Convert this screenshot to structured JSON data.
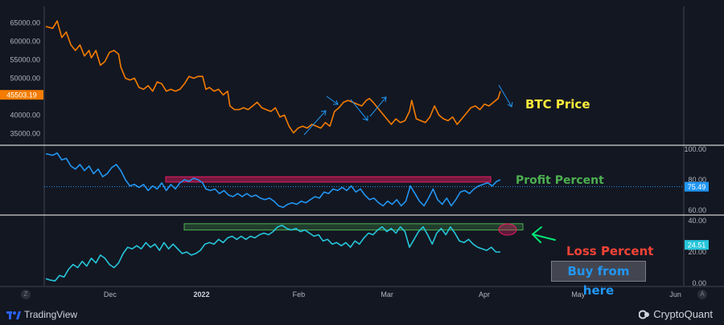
{
  "chart_data": [
    {
      "type": "line",
      "id": "btc-price",
      "series": [
        {
          "name": "BTC Price",
          "color": "#f57c00"
        }
      ],
      "y_ticks": [
        "65000.00",
        "60000.00",
        "55000.00",
        "50000.00",
        "40000.00",
        "35000.00"
      ],
      "y_tick_values": [
        65000,
        60000,
        55000,
        50000,
        40000,
        35000
      ],
      "ylim": [
        32500,
        69000
      ],
      "last_value_label": "45503.19",
      "last_value": 45503.19,
      "annotation": "BTC Price",
      "points": [
        [
          0,
          64000
        ],
        [
          0.015,
          63500
        ],
        [
          0.025,
          65500
        ],
        [
          0.035,
          61000
        ],
        [
          0.045,
          62500
        ],
        [
          0.055,
          59000
        ],
        [
          0.065,
          57500
        ],
        [
          0.075,
          59000
        ],
        [
          0.085,
          56000
        ],
        [
          0.095,
          57500
        ],
        [
          0.1,
          55500
        ],
        [
          0.11,
          57500
        ],
        [
          0.12,
          53500
        ],
        [
          0.13,
          54500
        ],
        [
          0.14,
          57000
        ],
        [
          0.15,
          57500
        ],
        [
          0.16,
          56500
        ],
        [
          0.165,
          53000
        ],
        [
          0.175,
          50000
        ],
        [
          0.185,
          49500
        ],
        [
          0.195,
          50000
        ],
        [
          0.205,
          47500
        ],
        [
          0.215,
          47000
        ],
        [
          0.225,
          48000
        ],
        [
          0.235,
          46500
        ],
        [
          0.245,
          49000
        ],
        [
          0.255,
          48500
        ],
        [
          0.265,
          46500
        ],
        [
          0.275,
          47000
        ],
        [
          0.285,
          46500
        ],
        [
          0.295,
          47000
        ],
        [
          0.305,
          48500
        ],
        [
          0.315,
          50500
        ],
        [
          0.325,
          50000
        ],
        [
          0.335,
          50500
        ],
        [
          0.345,
          50500
        ],
        [
          0.352,
          47000
        ],
        [
          0.36,
          47500
        ],
        [
          0.37,
          46500
        ],
        [
          0.38,
          47000
        ],
        [
          0.39,
          45500
        ],
        [
          0.4,
          46500
        ],
        [
          0.405,
          42500
        ],
        [
          0.415,
          41500
        ],
        [
          0.425,
          41500
        ],
        [
          0.435,
          42000
        ],
        [
          0.445,
          41500
        ],
        [
          0.455,
          42500
        ],
        [
          0.465,
          43500
        ],
        [
          0.475,
          42000
        ],
        [
          0.485,
          41500
        ],
        [
          0.495,
          41000
        ],
        [
          0.505,
          42000
        ],
        [
          0.515,
          39500
        ],
        [
          0.525,
          40000
        ],
        [
          0.535,
          37000
        ],
        [
          0.545,
          35200
        ],
        [
          0.555,
          36500
        ],
        [
          0.565,
          37000
        ],
        [
          0.575,
          36500
        ],
        [
          0.585,
          37500
        ],
        [
          0.595,
          37000
        ],
        [
          0.605,
          36500
        ],
        [
          0.615,
          38000
        ],
        [
          0.625,
          37000
        ],
        [
          0.635,
          41000
        ],
        [
          0.645,
          42000
        ],
        [
          0.655,
          43500
        ],
        [
          0.665,
          44000
        ],
        [
          0.675,
          43500
        ],
        [
          0.685,
          43000
        ],
        [
          0.695,
          42500
        ],
        [
          0.705,
          44000
        ],
        [
          0.712,
          44500
        ],
        [
          0.72,
          43500
        ],
        [
          0.73,
          42000
        ],
        [
          0.74,
          40500
        ],
        [
          0.75,
          39000
        ],
        [
          0.76,
          37500
        ],
        [
          0.77,
          39000
        ],
        [
          0.78,
          38000
        ],
        [
          0.79,
          38500
        ],
        [
          0.8,
          41000
        ],
        [
          0.805,
          44000
        ],
        [
          0.815,
          39000
        ],
        [
          0.825,
          38500
        ],
        [
          0.835,
          38000
        ],
        [
          0.845,
          39500
        ],
        [
          0.855,
          42500
        ],
        [
          0.865,
          40000
        ],
        [
          0.875,
          39000
        ],
        [
          0.885,
          38500
        ],
        [
          0.895,
          39500
        ],
        [
          0.905,
          37500
        ],
        [
          0.915,
          39000
        ],
        [
          0.925,
          40500
        ],
        [
          0.935,
          42000
        ],
        [
          0.945,
          42500
        ],
        [
          0.955,
          41500
        ],
        [
          0.965,
          43000
        ],
        [
          0.975,
          42500
        ],
        [
          0.985,
          43500
        ],
        [
          0.995,
          44500
        ],
        [
          1.0,
          46500
        ]
      ]
    },
    {
      "type": "line",
      "id": "profit-percent",
      "series": [
        {
          "name": "Profit Percent",
          "color": "#2196f3"
        }
      ],
      "y_ticks": [
        "100.00",
        "80.00",
        "60.00"
      ],
      "y_tick_values": [
        100,
        80,
        60
      ],
      "ylim": [
        58,
        101
      ],
      "last_value_label": "75.49",
      "last_value": 75.49,
      "annotation": "Profit Percent",
      "highlight_band": [
        78.5,
        82
      ],
      "points": [
        [
          0,
          97
        ],
        [
          0.015,
          96
        ],
        [
          0.025,
          97.5
        ],
        [
          0.035,
          93
        ],
        [
          0.045,
          94
        ],
        [
          0.055,
          89
        ],
        [
          0.065,
          87
        ],
        [
          0.075,
          90
        ],
        [
          0.085,
          86
        ],
        [
          0.095,
          89
        ],
        [
          0.105,
          84
        ],
        [
          0.115,
          87
        ],
        [
          0.125,
          82
        ],
        [
          0.135,
          84
        ],
        [
          0.145,
          88
        ],
        [
          0.155,
          90
        ],
        [
          0.165,
          86
        ],
        [
          0.175,
          80
        ],
        [
          0.185,
          76
        ],
        [
          0.195,
          77
        ],
        [
          0.205,
          75
        ],
        [
          0.215,
          77
        ],
        [
          0.225,
          73
        ],
        [
          0.235,
          76
        ],
        [
          0.245,
          74
        ],
        [
          0.255,
          78
        ],
        [
          0.265,
          73
        ],
        [
          0.275,
          77
        ],
        [
          0.285,
          74
        ],
        [
          0.295,
          78
        ],
        [
          0.305,
          80
        ],
        [
          0.315,
          79
        ],
        [
          0.325,
          81
        ],
        [
          0.335,
          80
        ],
        [
          0.345,
          78
        ],
        [
          0.352,
          74
        ],
        [
          0.362,
          73
        ],
        [
          0.372,
          74
        ],
        [
          0.382,
          71
        ],
        [
          0.392,
          73
        ],
        [
          0.402,
          70
        ],
        [
          0.412,
          69
        ],
        [
          0.422,
          71
        ],
        [
          0.432,
          69
        ],
        [
          0.442,
          71
        ],
        [
          0.452,
          69
        ],
        [
          0.462,
          70
        ],
        [
          0.472,
          68
        ],
        [
          0.482,
          67
        ],
        [
          0.492,
          68
        ],
        [
          0.502,
          66
        ],
        [
          0.512,
          63
        ],
        [
          0.522,
          62
        ],
        [
          0.532,
          64
        ],
        [
          0.542,
          65
        ],
        [
          0.552,
          64
        ],
        [
          0.562,
          66
        ],
        [
          0.572,
          65
        ],
        [
          0.582,
          67
        ],
        [
          0.592,
          69
        ],
        [
          0.602,
          68
        ],
        [
          0.612,
          72
        ],
        [
          0.622,
          71
        ],
        [
          0.632,
          74
        ],
        [
          0.642,
          73
        ],
        [
          0.652,
          75
        ],
        [
          0.662,
          73
        ],
        [
          0.672,
          76
        ],
        [
          0.682,
          72
        ],
        [
          0.692,
          74
        ],
        [
          0.702,
          70
        ],
        [
          0.712,
          67
        ],
        [
          0.722,
          68
        ],
        [
          0.732,
          65
        ],
        [
          0.742,
          63
        ],
        [
          0.752,
          66
        ],
        [
          0.762,
          64
        ],
        [
          0.772,
          67
        ],
        [
          0.782,
          63
        ],
        [
          0.792,
          66
        ],
        [
          0.802,
          76
        ],
        [
          0.812,
          71
        ],
        [
          0.822,
          66
        ],
        [
          0.832,
          63
        ],
        [
          0.842,
          68
        ],
        [
          0.852,
          74
        ],
        [
          0.862,
          67
        ],
        [
          0.872,
          64
        ],
        [
          0.882,
          68
        ],
        [
          0.892,
          63
        ],
        [
          0.902,
          67
        ],
        [
          0.912,
          72
        ],
        [
          0.922,
          73
        ],
        [
          0.932,
          71
        ],
        [
          0.942,
          74
        ],
        [
          0.952,
          76
        ],
        [
          0.962,
          77
        ],
        [
          0.972,
          78
        ],
        [
          0.982,
          76
        ],
        [
          0.992,
          79
        ],
        [
          1.0,
          80
        ]
      ]
    },
    {
      "type": "line",
      "id": "loss-percent",
      "series": [
        {
          "name": "Loss Percent",
          "color": "#26c6da"
        }
      ],
      "y_ticks": [
        "40.00",
        "20.00",
        "0.00"
      ],
      "y_tick_values": [
        40,
        20,
        0
      ],
      "ylim": [
        -1,
        42
      ],
      "last_value_label": "24.51",
      "last_value": 24.51,
      "annotation": "Loss Percent",
      "highlight_band": [
        34,
        38
      ],
      "points": [
        [
          0,
          3
        ],
        [
          0.01,
          2
        ],
        [
          0.02,
          1.5
        ],
        [
          0.03,
          5
        ],
        [
          0.04,
          4
        ],
        [
          0.05,
          9
        ],
        [
          0.06,
          12
        ],
        [
          0.07,
          10
        ],
        [
          0.08,
          14
        ],
        [
          0.09,
          11
        ],
        [
          0.1,
          16
        ],
        [
          0.11,
          13
        ],
        [
          0.12,
          18
        ],
        [
          0.13,
          16
        ],
        [
          0.14,
          12
        ],
        [
          0.15,
          10
        ],
        [
          0.16,
          13
        ],
        [
          0.17,
          19
        ],
        [
          0.18,
          23
        ],
        [
          0.19,
          22
        ],
        [
          0.2,
          24
        ],
        [
          0.21,
          22
        ],
        [
          0.22,
          26
        ],
        [
          0.23,
          23
        ],
        [
          0.24,
          25
        ],
        [
          0.25,
          21
        ],
        [
          0.26,
          26
        ],
        [
          0.27,
          22
        ],
        [
          0.28,
          25
        ],
        [
          0.29,
          22
        ],
        [
          0.3,
          19
        ],
        [
          0.31,
          20
        ],
        [
          0.32,
          18
        ],
        [
          0.33,
          19
        ],
        [
          0.34,
          21
        ],
        [
          0.35,
          25
        ],
        [
          0.36,
          26
        ],
        [
          0.37,
          25
        ],
        [
          0.38,
          28
        ],
        [
          0.39,
          26
        ],
        [
          0.4,
          29
        ],
        [
          0.41,
          30
        ],
        [
          0.42,
          28
        ],
        [
          0.43,
          30
        ],
        [
          0.44,
          28
        ],
        [
          0.45,
          30
        ],
        [
          0.46,
          29
        ],
        [
          0.47,
          31
        ],
        [
          0.48,
          32
        ],
        [
          0.49,
          31
        ],
        [
          0.5,
          33
        ],
        [
          0.51,
          36
        ],
        [
          0.52,
          37
        ],
        [
          0.53,
          35
        ],
        [
          0.54,
          34
        ],
        [
          0.55,
          35
        ],
        [
          0.56,
          33
        ],
        [
          0.57,
          34
        ],
        [
          0.58,
          32
        ],
        [
          0.59,
          30
        ],
        [
          0.6,
          31
        ],
        [
          0.61,
          27
        ],
        [
          0.62,
          28
        ],
        [
          0.63,
          25
        ],
        [
          0.64,
          26
        ],
        [
          0.65,
          24
        ],
        [
          0.66,
          26
        ],
        [
          0.67,
          23
        ],
        [
          0.68,
          27
        ],
        [
          0.69,
          25
        ],
        [
          0.7,
          29
        ],
        [
          0.71,
          32
        ],
        [
          0.72,
          31
        ],
        [
          0.73,
          34
        ],
        [
          0.74,
          36
        ],
        [
          0.75,
          33
        ],
        [
          0.76,
          35
        ],
        [
          0.77,
          32
        ],
        [
          0.78,
          36
        ],
        [
          0.79,
          33
        ],
        [
          0.8,
          23
        ],
        [
          0.81,
          28
        ],
        [
          0.82,
          33
        ],
        [
          0.83,
          36
        ],
        [
          0.84,
          31
        ],
        [
          0.85,
          25
        ],
        [
          0.86,
          32
        ],
        [
          0.87,
          35
        ],
        [
          0.88,
          31
        ],
        [
          0.89,
          36
        ],
        [
          0.9,
          32
        ],
        [
          0.91,
          27
        ],
        [
          0.92,
          26
        ],
        [
          0.93,
          28
        ],
        [
          0.94,
          25
        ],
        [
          0.95,
          23
        ],
        [
          0.96,
          22
        ],
        [
          0.97,
          21
        ],
        [
          0.98,
          23
        ],
        [
          0.99,
          20
        ],
        [
          1.0,
          20
        ]
      ]
    }
  ],
  "x_axis": {
    "labels": [
      {
        "text": "Dec",
        "frac": 0.103,
        "bold": false
      },
      {
        "text": "2022",
        "frac": 0.246,
        "bold": true
      },
      {
        "text": "Feb",
        "frac": 0.398,
        "bold": false
      },
      {
        "text": "Mar",
        "frac": 0.536,
        "bold": false
      },
      {
        "text": "Apr",
        "frac": 0.688,
        "bold": false
      },
      {
        "text": "May",
        "frac": 0.835,
        "bold": false
      },
      {
        "text": "Jun",
        "frac": 0.987,
        "bold": false
      }
    ]
  },
  "annotations": {
    "btc_label": "BTC Price",
    "profit_label": "Profit Percent",
    "loss_label": "Loss Percent",
    "buy_label": "Buy from here"
  },
  "footer": {
    "tradingview": "TradingView",
    "cryptoquant": "CryptoQuant",
    "corner_left": "Z",
    "corner_right": "A"
  },
  "colors": {
    "background": "#131722",
    "btc": "#f57c00",
    "profit": "#2196f3",
    "loss": "#26c6da",
    "btc_label": "#ffeb3b",
    "profit_label": "#4caf50",
    "loss_label": "#f44336",
    "buy_label": "#2196f3",
    "arrow_green": "#00e676"
  }
}
